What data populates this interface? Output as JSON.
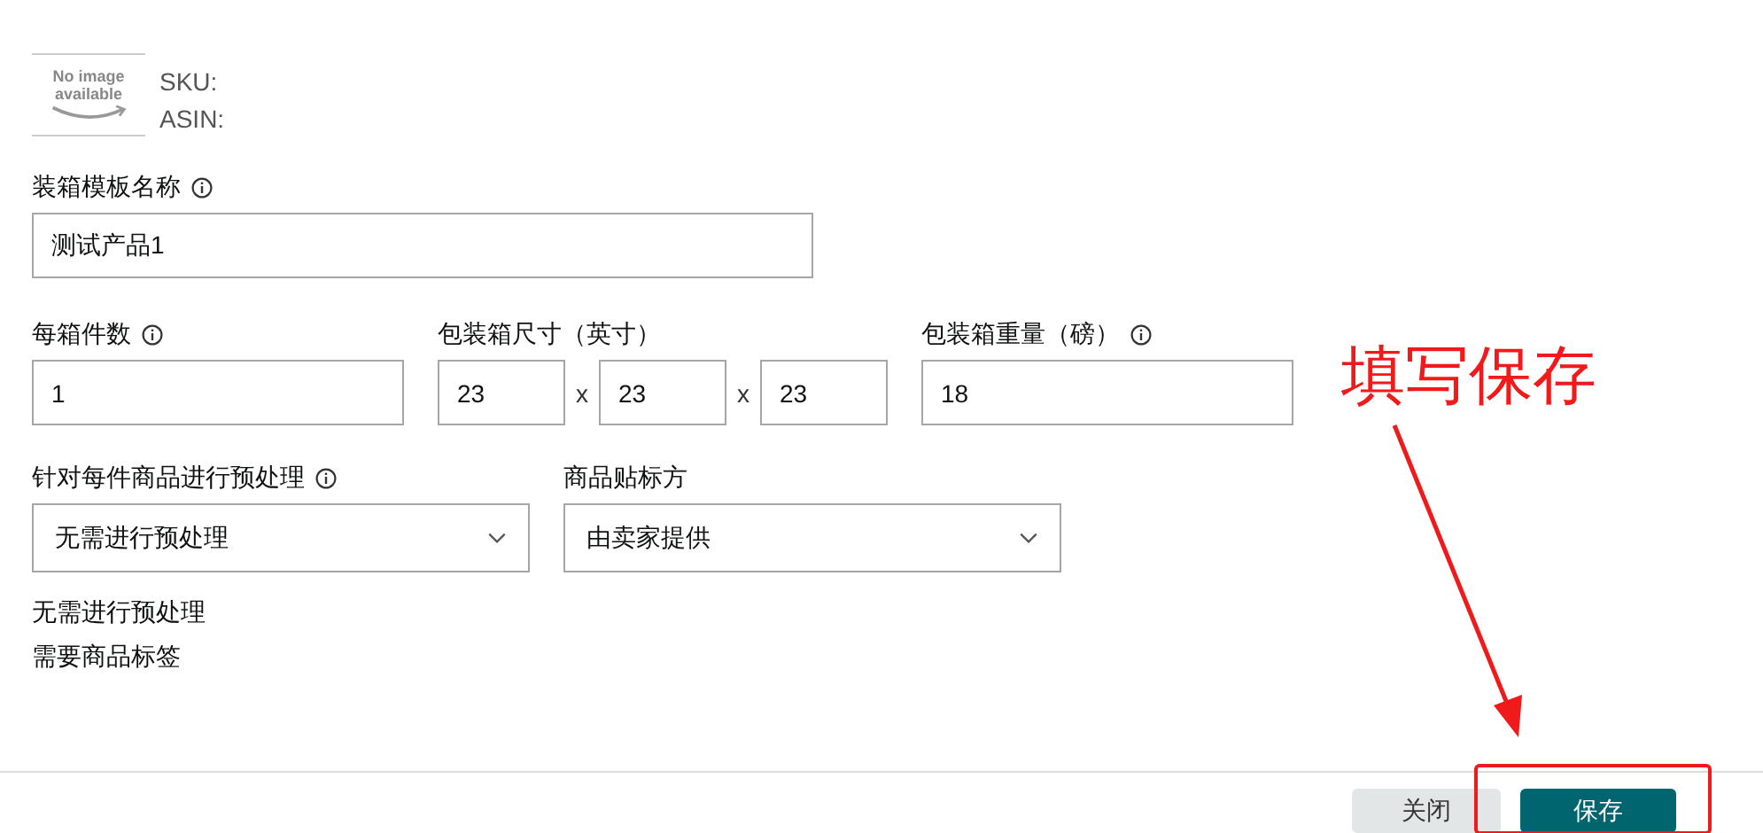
{
  "product": {
    "image_text": "No image available",
    "sku_label": "SKU:",
    "asin_label": "ASIN:"
  },
  "template_name": {
    "label": "装箱模板名称",
    "value": "测试产品1"
  },
  "units_per_box": {
    "label": "每箱件数",
    "value": "1"
  },
  "box_dimensions": {
    "label": "包装箱尺寸（英寸）",
    "separators": [
      "x",
      "x"
    ],
    "values": [
      "23",
      "23",
      "23"
    ]
  },
  "box_weight": {
    "label": "包装箱重量（磅）",
    "value": "18"
  },
  "prep": {
    "label": "针对每件商品进行预处理",
    "value": "无需进行预处理"
  },
  "labeling": {
    "label": "商品贴标方",
    "value": "由卖家提供"
  },
  "notes": [
    "无需进行预处理",
    "需要商品标签"
  ],
  "buttons": [
    {
      "label": "关闭",
      "kind": "secondary"
    },
    {
      "label": "保存",
      "kind": "primary"
    }
  ],
  "annotation": {
    "text": "填写保存"
  }
}
